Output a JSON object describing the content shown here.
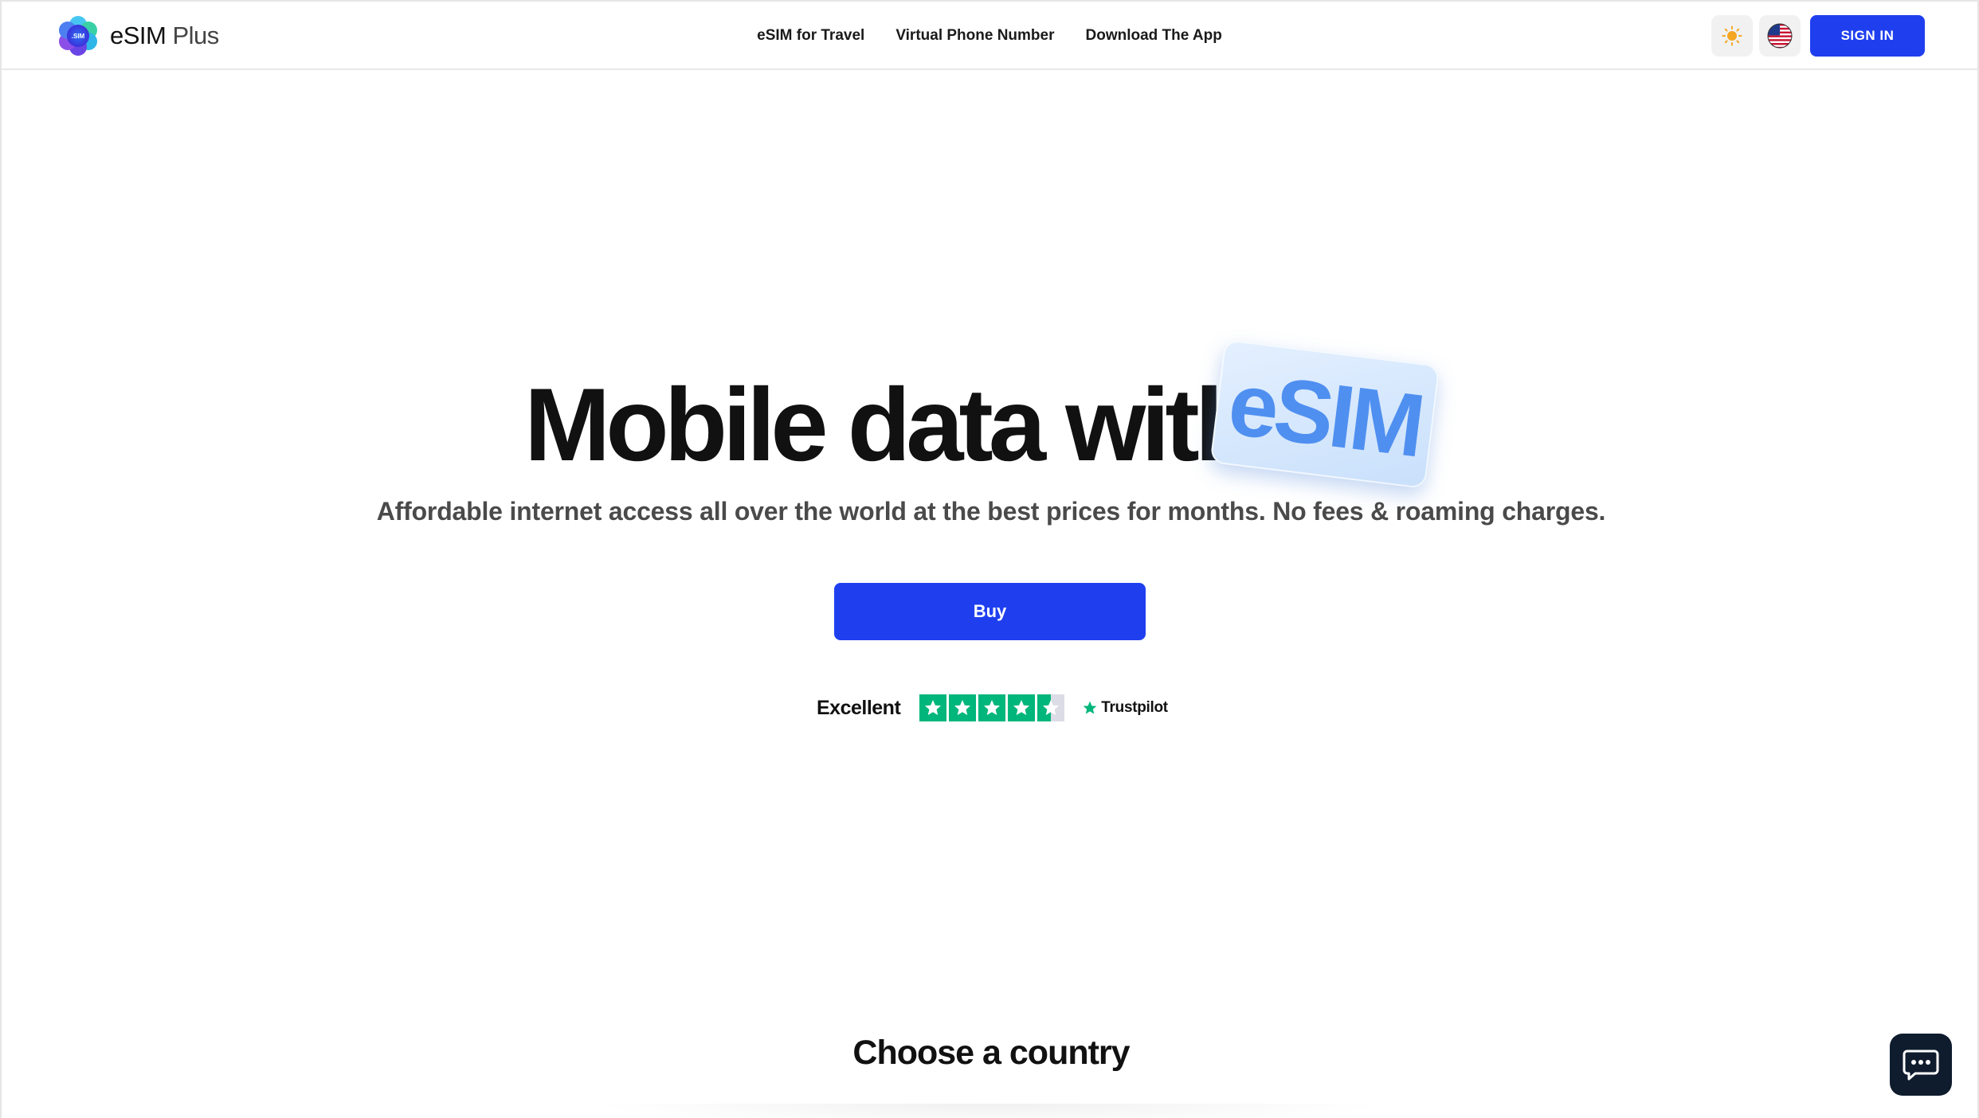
{
  "header": {
    "logo": {
      "badge_text": ".SIM",
      "name": "eSIM",
      "suffix": " Plus"
    },
    "nav": [
      {
        "label": "eSIM for Travel"
      },
      {
        "label": "Virtual Phone Number"
      },
      {
        "label": "Download The App"
      }
    ],
    "theme_icon": "sun-icon",
    "language_icon": "us-flag-icon",
    "signin_label": "SIGN IN"
  },
  "hero": {
    "title": "Mobile data with",
    "badge": "eSIM",
    "subtitle": "Affordable internet access all over the world at the best prices for months. No fees & roaming charges.",
    "buy_label": "Buy"
  },
  "rating": {
    "label": "Excellent",
    "stars": 4.5,
    "provider": "Trustpilot"
  },
  "section": {
    "title": "Choose a country"
  },
  "chat_icon": "chat-bubble-icon",
  "colors": {
    "primary": "#1f3fef",
    "trustpilot_green": "#00b67a",
    "badge_text": "#4f8ff0",
    "chat_bg": "#0f1c2e"
  }
}
